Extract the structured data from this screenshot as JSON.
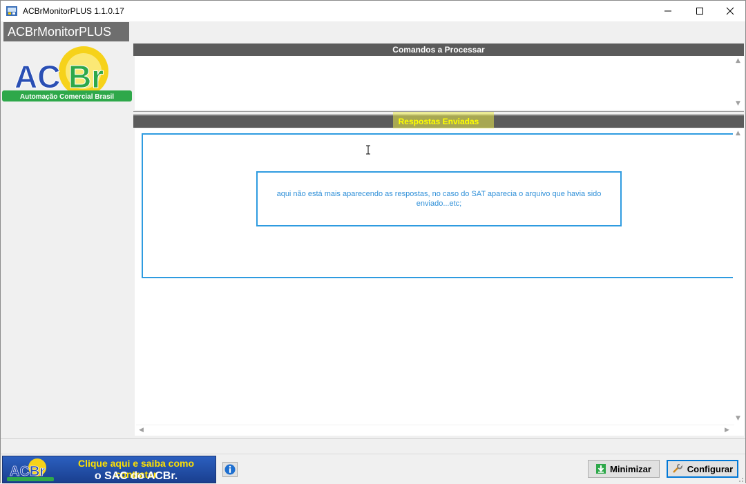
{
  "window": {
    "title": "ACBrMonitorPLUS 1.1.0.17"
  },
  "sidebar": {
    "brand_label": "ACBrMonitorPLUS",
    "logo": {
      "text": "ACBr",
      "tagline": "Automação Comercial Brasil"
    }
  },
  "commands_panel": {
    "header": "Comandos a Processar"
  },
  "responses_panel": {
    "header": "Respostas Enviadas",
    "annotation": "aqui não está mais aparecendo as respostas, no caso do SAT aparecia o arquivo que havia sido enviado...etc;"
  },
  "footer": {
    "banner": {
      "logo_text": "ACBr",
      "line1": "Clique aqui e saiba como contratar",
      "line2": "o SAC do ACBr."
    },
    "minimize_label": "Minimizar",
    "configure_label": "Configurar"
  },
  "colors": {
    "header_bg": "#5b5b5b",
    "highlight": "#e8e84a",
    "annotation": "#2e9be0",
    "focus": "#0078d7"
  }
}
